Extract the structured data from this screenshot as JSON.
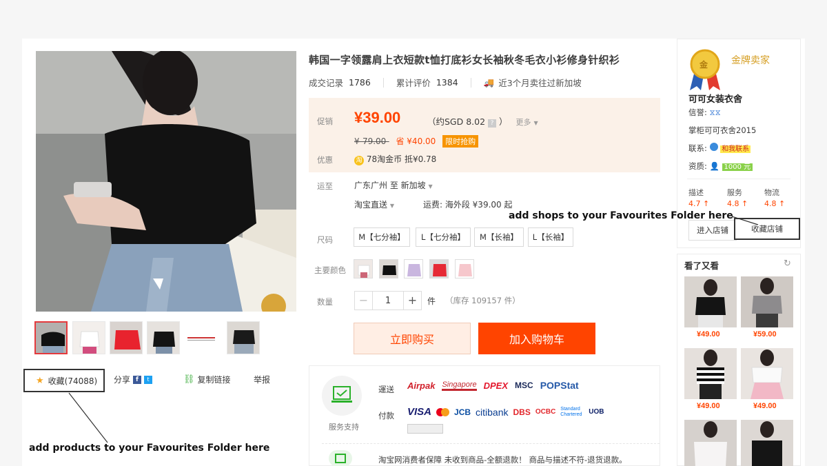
{
  "product": {
    "title": "韩国一字领露肩上衣短款t恤打底衫女长袖秋冬毛衣小衫修身针织衫",
    "stats": {
      "deals_label": "成交记录",
      "deals_count": "1786",
      "reviews_label": "累计评价",
      "reviews_count": "1384",
      "shipping_note": "近3个月卖往过新加坡"
    }
  },
  "price": {
    "promo_label": "促销",
    "price": "¥39.00",
    "sgd": "（约SGD 8.02",
    "sgd_close": "）",
    "more": "更多",
    "original": "¥-79.00-",
    "save": "省 ¥40.00",
    "flash_tag": "限时抢购",
    "discount_label": "优惠",
    "coin": "78淘金币",
    "coin_value": "抵¥0.78"
  },
  "shipping": {
    "label": "运至",
    "route": "广东广州 至  新加坡",
    "method": "淘宝直送",
    "fee": "运费: 海外段 ¥39.00 起"
  },
  "sizes": {
    "label": "尺码",
    "options": [
      "M【七分袖】",
      "L【七分袖】",
      "M【长袖】",
      "L【长袖】"
    ]
  },
  "colors": {
    "label": "主要颜色"
  },
  "quantity": {
    "label": "数量",
    "value": "1",
    "unit": "件",
    "stock": "（库存 109157 件）"
  },
  "actions": {
    "buy_now": "立即购买",
    "add_cart": "加入购物车"
  },
  "gallery": {
    "favorites": "收藏(74088)",
    "share": "分享",
    "copy_link": "复制链接",
    "report": "举报",
    "annotation": "add products to your Favourites Folder here"
  },
  "service": {
    "title": "服务支持",
    "delivery_label": "運送",
    "payment_label": "付款",
    "carriers": [
      "Airpak",
      "Singapore",
      "DPEX",
      "MSC",
      "POPStat"
    ],
    "payments": [
      "VISA",
      "MC",
      "JCB",
      "citibank",
      "DBS",
      "OCBC",
      "Standard Chartered",
      "UOB"
    ],
    "guarantee": "淘宝网消费者保障    未收到商品-全额退款！ 商品与描述不符-退货退款。"
  },
  "shop": {
    "badge": "金",
    "tier": "金牌卖家",
    "name": "可可女装衣舍",
    "credit_label": "信誉:",
    "keeper": "掌柜可可衣舍2015",
    "contact_label": "联系:",
    "contact_tag": "和我联系",
    "qualification_label": "资质:",
    "qualification_tag": "1000 元",
    "scores": [
      {
        "label": "描述",
        "value": "4.7 ↑"
      },
      {
        "label": "服务",
        "value": "4.8 ↑"
      },
      {
        "label": "物流",
        "value": "4.8 ↑"
      }
    ],
    "enter_shop": "进入店铺",
    "collect_shop": "收藏店铺",
    "annotation": "add shops to your Favourites Folder here"
  },
  "recommend": {
    "title": "看了又看",
    "prices": [
      "¥49.00",
      "¥59.00",
      "¥49.00",
      "¥49.00"
    ]
  },
  "colors_hex": {
    "accent": "#ff4400",
    "price": "#ff4400",
    "price_bg": "#fbf1e8",
    "flash": "#f79400"
  }
}
